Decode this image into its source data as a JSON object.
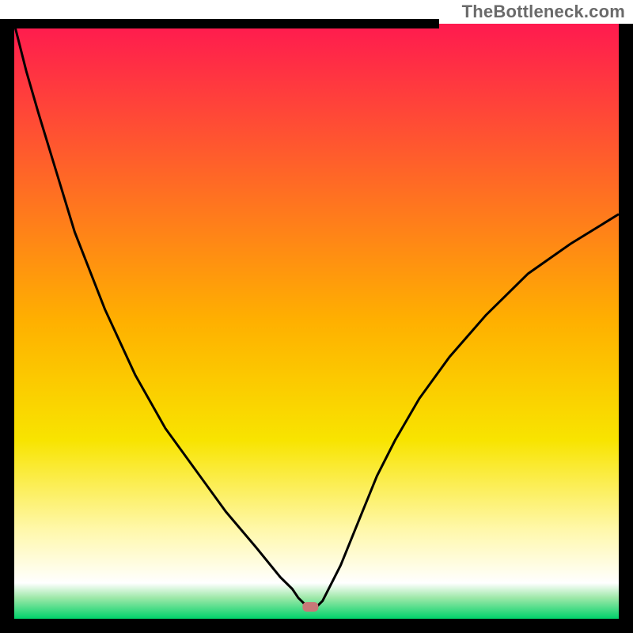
{
  "watermark": {
    "text": "TheBottleneck.com"
  },
  "chart_data": {
    "type": "line",
    "title": "",
    "xlabel": "",
    "ylabel": "",
    "x": [
      0,
      2,
      4,
      7,
      10,
      15,
      20,
      25,
      30,
      35,
      40,
      44,
      46,
      47,
      48,
      49,
      50,
      51,
      52,
      54,
      56,
      58,
      60,
      63,
      67,
      72,
      78,
      85,
      92,
      100
    ],
    "values": [
      100,
      92,
      85,
      75,
      65,
      52,
      41,
      32,
      25,
      18,
      12,
      7,
      5,
      3.5,
      2.5,
      2,
      2,
      3,
      5,
      9,
      14,
      19,
      24,
      30,
      37,
      44,
      51,
      58,
      63,
      68
    ],
    "xlim": [
      0,
      100
    ],
    "ylim": [
      0,
      100
    ],
    "marker": {
      "x": 49,
      "y": 2.0,
      "color": "#c87878"
    },
    "background_gradient": [
      {
        "stop": 0.0,
        "color": "#ff1a4f"
      },
      {
        "stop": 0.5,
        "color": "#ffb000"
      },
      {
        "stop": 0.7,
        "color": "#f8e400"
      },
      {
        "stop": 0.85,
        "color": "#fff8aa"
      },
      {
        "stop": 0.94,
        "color": "#ffffff"
      },
      {
        "stop": 0.965,
        "color": "#9de8a8"
      },
      {
        "stop": 1.0,
        "color": "#00d26a"
      }
    ],
    "frame_color": "#000000",
    "frame_thickness_px": 18,
    "curve_color": "#000000",
    "curve_thickness_px": 3
  }
}
